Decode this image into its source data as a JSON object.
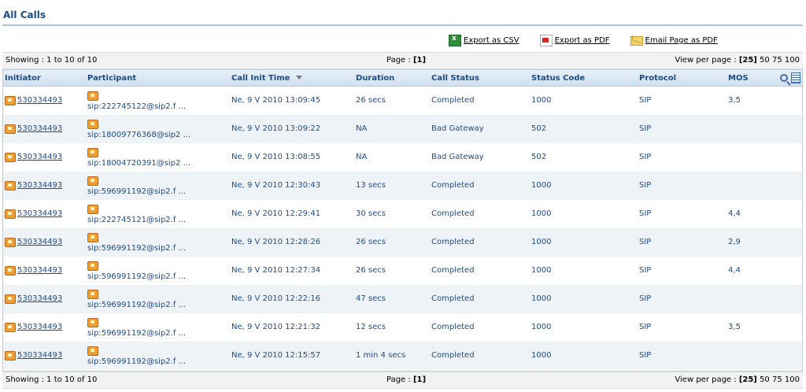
{
  "page": {
    "title": "All Calls"
  },
  "exports": {
    "csv": "Export as CSV",
    "pdf": "Export as PDF",
    "email": "Email Page as PDF"
  },
  "pager": {
    "showing": "Showing : 1 to 10 of 10",
    "page_label": "Page : ",
    "page_current": "[1]",
    "view_label": "View per page : ",
    "view_current": "[25]",
    "view_50": "50",
    "view_75": "75",
    "view_100": "100"
  },
  "table": {
    "headers": {
      "initiator": "Initiator",
      "participant": "Participant",
      "call_init_time": "Call Init Time",
      "duration": "Duration",
      "call_status": "Call Status",
      "status_code": "Status Code",
      "protocol": "Protocol",
      "mos": "MOS"
    },
    "rows": [
      {
        "initiator": "530334493",
        "participant": "sip:222745122@sip2.f ...",
        "time": "Ne, 9 V 2010 13:09:45",
        "duration": "26 secs",
        "status": "Completed",
        "code": "1000",
        "protocol": "SIP",
        "mos": "3,5"
      },
      {
        "initiator": "530334493",
        "participant": "sip:18009776368@sip2 ...",
        "time": "Ne, 9 V 2010 13:09:22",
        "duration": "NA",
        "status": "Bad Gateway",
        "code": "502",
        "protocol": "SIP",
        "mos": ""
      },
      {
        "initiator": "530334493",
        "participant": "sip:18004720391@sip2 ...",
        "time": "Ne, 9 V 2010 13:08:55",
        "duration": "NA",
        "status": "Bad Gateway",
        "code": "502",
        "protocol": "SIP",
        "mos": ""
      },
      {
        "initiator": "530334493",
        "participant": "sip:596991192@sip2.f ...",
        "time": "Ne, 9 V 2010 12:30:43",
        "duration": "13 secs",
        "status": "Completed",
        "code": "1000",
        "protocol": "SIP",
        "mos": ""
      },
      {
        "initiator": "530334493",
        "participant": "sip:222745121@sip2.f ...",
        "time": "Ne, 9 V 2010 12:29:41",
        "duration": "30 secs",
        "status": "Completed",
        "code": "1000",
        "protocol": "SIP",
        "mos": "4,4"
      },
      {
        "initiator": "530334493",
        "participant": "sip:596991192@sip2.f ...",
        "time": "Ne, 9 V 2010 12:28:26",
        "duration": "26 secs",
        "status": "Completed",
        "code": "1000",
        "protocol": "SIP",
        "mos": "2,9"
      },
      {
        "initiator": "530334493",
        "participant": "sip:596991192@sip2.f ...",
        "time": "Ne, 9 V 2010 12:27:34",
        "duration": "26 secs",
        "status": "Completed",
        "code": "1000",
        "protocol": "SIP",
        "mos": "4,4"
      },
      {
        "initiator": "530334493",
        "participant": "sip:596991192@sip2.f ...",
        "time": "Ne, 9 V 2010 12:22:16",
        "duration": "47 secs",
        "status": "Completed",
        "code": "1000",
        "protocol": "SIP",
        "mos": ""
      },
      {
        "initiator": "530334493",
        "participant": "sip:596991192@sip2.f ...",
        "time": "Ne, 9 V 2010 12:21:32",
        "duration": "12 secs",
        "status": "Completed",
        "code": "1000",
        "protocol": "SIP",
        "mos": "3,5"
      },
      {
        "initiator": "530334493",
        "participant": "sip:596991192@sip2.f ...",
        "time": "Ne, 9 V 2010 12:15:57",
        "duration": "1 min 4 secs",
        "status": "Completed",
        "code": "1000",
        "protocol": "SIP",
        "mos": ""
      }
    ]
  }
}
